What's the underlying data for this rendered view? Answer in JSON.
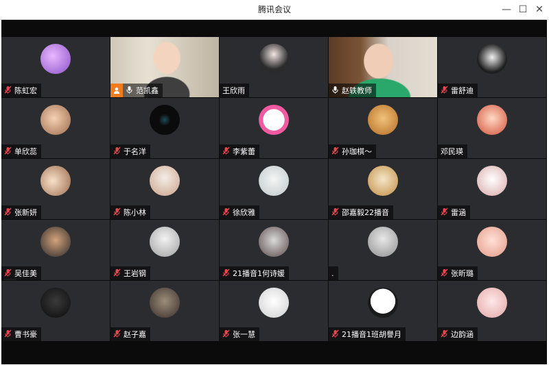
{
  "window": {
    "title": "腾讯会议",
    "controls": [
      "—",
      "☐",
      "✕"
    ]
  },
  "participants": [
    {
      "name": "陈虹宏",
      "muted": true,
      "avatar": "purple-girl",
      "video": false
    },
    {
      "name": "范凯鑫",
      "muted": false,
      "avatar": "boy-video",
      "video": true,
      "host": true
    },
    {
      "name": "王欣雨",
      "muted": false,
      "avatar": "dark-hair",
      "video": false,
      "no_mic_icon": true
    },
    {
      "name": "赵轶教师",
      "muted": false,
      "avatar": "teacher-video",
      "video": true
    },
    {
      "name": "雷舒迪",
      "muted": true,
      "avatar": "bw-girl",
      "video": false
    },
    {
      "name": "单欣蕊",
      "muted": true,
      "avatar": "baby",
      "video": false
    },
    {
      "name": "于名洋",
      "muted": true,
      "avatar": "planet",
      "video": false
    },
    {
      "name": "李紫蕾",
      "muted": true,
      "avatar": "pink-heart",
      "video": false
    },
    {
      "name": "孙珈棋～",
      "muted": true,
      "avatar": "dog",
      "video": false
    },
    {
      "name": "邓民瑛",
      "muted": false,
      "avatar": "child-red",
      "video": false,
      "no_mic_icon": true
    },
    {
      "name": "张新妍",
      "muted": true,
      "avatar": "hand-face",
      "video": false
    },
    {
      "name": "陈小林",
      "muted": true,
      "avatar": "girl-light",
      "video": false
    },
    {
      "name": "徐欣雅",
      "muted": true,
      "avatar": "girl-white",
      "video": false
    },
    {
      "name": "邵嘉毅22播音",
      "muted": true,
      "avatar": "cat-cartoon",
      "video": false
    },
    {
      "name": "雷涵",
      "muted": true,
      "avatar": "cartoon-boy",
      "video": false
    },
    {
      "name": "吴佳美",
      "muted": true,
      "avatar": "man-face",
      "video": false
    },
    {
      "name": "王岩钢",
      "muted": true,
      "avatar": "boy-white",
      "video": false
    },
    {
      "name": "21播音1何诗媛",
      "muted": true,
      "avatar": "group",
      "video": false
    },
    {
      "name": ".",
      "muted": false,
      "avatar": "grey-sky",
      "video": false,
      "no_mic_icon": true
    },
    {
      "name": "张昕璐",
      "muted": true,
      "avatar": "girl-pink",
      "video": false
    },
    {
      "name": "曹书豪",
      "muted": true,
      "avatar": "dark-boy",
      "video": false
    },
    {
      "name": "赵子嘉",
      "muted": true,
      "avatar": "group-dark",
      "video": false
    },
    {
      "name": "张一慧",
      "muted": true,
      "avatar": "white-figure",
      "video": false
    },
    {
      "name": "21播音1班胡譽月",
      "muted": true,
      "avatar": "penguin",
      "video": false
    },
    {
      "name": "边韵涵",
      "muted": true,
      "avatar": "cute-girl",
      "video": false
    }
  ],
  "colors": {
    "tile_bg": "#2b2c30",
    "stage_bg": "#0b0b0b",
    "muted_red": "#e5484d",
    "host_orange": "#f07c1e"
  }
}
